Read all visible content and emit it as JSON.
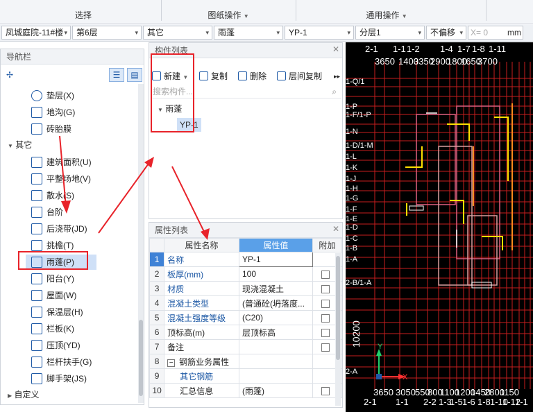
{
  "ribbon": {
    "groups": [
      {
        "label": "选择"
      },
      {
        "label": "图纸操作"
      },
      {
        "label": "通用操作"
      }
    ]
  },
  "selectors": [
    {
      "value": "凤城庭院-11#楼"
    },
    {
      "value": "第6层"
    },
    {
      "value": "其它"
    },
    {
      "value": "雨蓬"
    },
    {
      "value": "YP-1"
    },
    {
      "value": "分层1"
    },
    {
      "value": "不偏移"
    }
  ],
  "coord": {
    "x_label": "X=",
    "x_value": "0",
    "unit": "mm"
  },
  "nav": {
    "title": "导航栏",
    "items_top": [
      {
        "label": "垫层(X)"
      },
      {
        "label": "地沟(G)"
      },
      {
        "label": "砖胎膜"
      }
    ],
    "category": "其它",
    "items": [
      {
        "label": "建筑面积(U)"
      },
      {
        "label": "平整场地(V)"
      },
      {
        "label": "散水(S)"
      },
      {
        "label": "台阶"
      },
      {
        "label": "后浇带(JD)"
      },
      {
        "label": "挑檐(T)"
      },
      {
        "label": "雨蓬(P)"
      },
      {
        "label": "阳台(Y)"
      },
      {
        "label": "屋面(W)"
      },
      {
        "label": "保温层(H)"
      },
      {
        "label": "栏板(K)"
      },
      {
        "label": "压顶(YD)"
      },
      {
        "label": "栏杆扶手(G)"
      },
      {
        "label": "脚手架(JS)"
      }
    ],
    "custom": "自定义"
  },
  "components": {
    "title": "构件列表",
    "toolbar": {
      "new": "新建",
      "copy": "复制",
      "delete": "删除",
      "floor_copy": "层间复制"
    },
    "search_placeholder": "搜索构件...",
    "tree_root": "雨蓬",
    "tree_child": "YP-1"
  },
  "props": {
    "title": "属性列表",
    "headers": {
      "name": "属性名称",
      "value": "属性值",
      "extra": "附加"
    },
    "rows": [
      {
        "n": "1",
        "name": "名称",
        "value": "YP-1"
      },
      {
        "n": "2",
        "name": "板厚(mm)",
        "value": "100"
      },
      {
        "n": "3",
        "name": "材质",
        "value": "现浇混凝土"
      },
      {
        "n": "4",
        "name": "混凝土类型",
        "value": "(普通砼(坍落度..."
      },
      {
        "n": "5",
        "name": "混凝土强度等级",
        "value": "(C20)"
      },
      {
        "n": "6",
        "name": "顶标高(m)",
        "value": "层顶标高"
      },
      {
        "n": "7",
        "name": "备注",
        "value": ""
      },
      {
        "n": "8",
        "name": "钢筋业务属性",
        "value": ""
      },
      {
        "n": "9",
        "name": "其它钢筋",
        "value": ""
      },
      {
        "n": "10",
        "name": "汇总信息",
        "value": "(雨蓬)"
      }
    ]
  },
  "cad": {
    "top_axes1": [
      "2-1",
      "1-1",
      "1-2",
      "1-4",
      "1-7",
      "1-8",
      "1-11"
    ],
    "top_dims": [
      "3650",
      "1400",
      "3350",
      "2900",
      "1800",
      "1650",
      "3700"
    ],
    "left_axes": [
      "1-Q/1",
      "1-P",
      "1-F/1-P",
      "1-N",
      "1-D/1-M",
      "1-L",
      "1-K",
      "1-J",
      "1-H",
      "1-G",
      "1-F",
      "1-E",
      "1-D",
      "1-C",
      "1-B",
      "1-A",
      "2-B/1-A",
      "2-A"
    ],
    "left_dims": [
      "10200"
    ],
    "bottom_dims": [
      "3650",
      "3050",
      "550",
      "800",
      "1100",
      "1200",
      "1450",
      "2800",
      "1150"
    ],
    "bottom_axes": [
      "2-1",
      "1-1",
      "2-2",
      "1-3",
      "1-5",
      "1-6",
      "1-8",
      "1-10",
      "1-12",
      "1-1"
    ],
    "axis_labels": {
      "x": "X",
      "y": "Y"
    }
  }
}
